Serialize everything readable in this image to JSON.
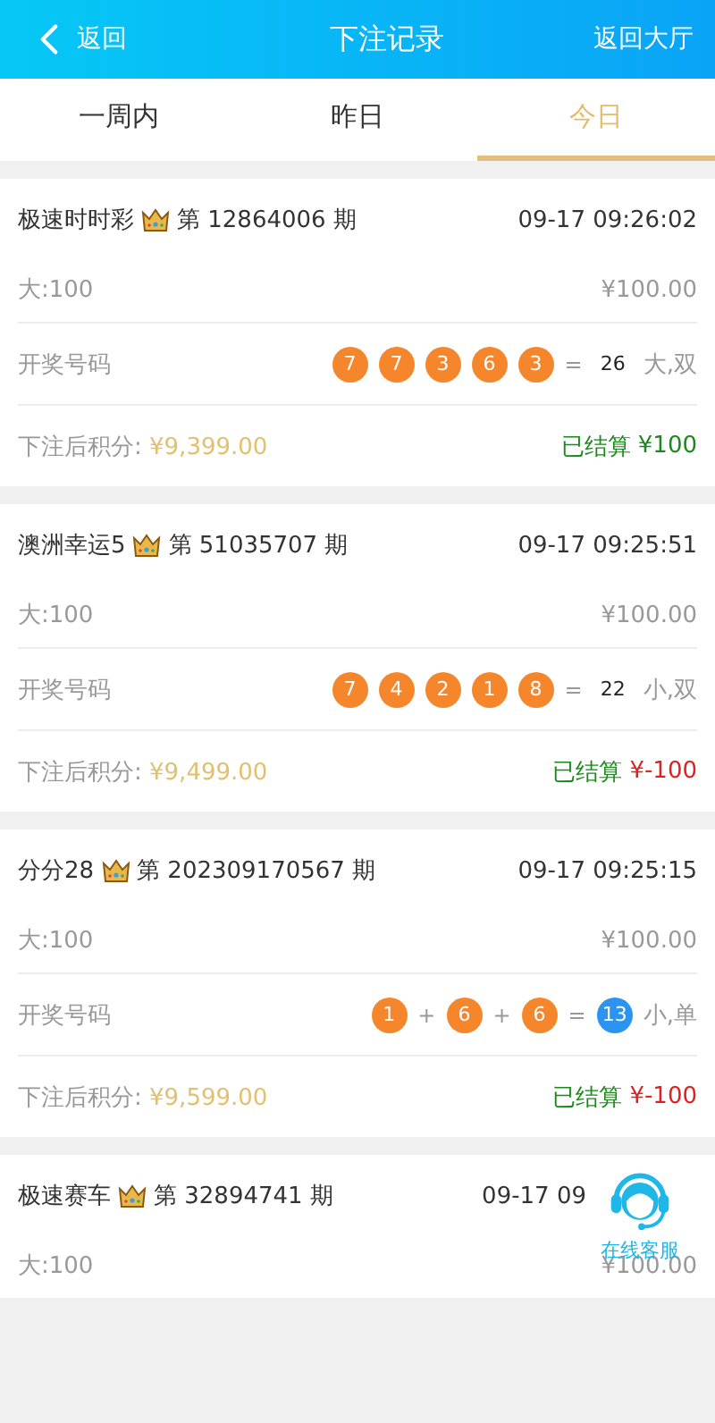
{
  "header": {
    "back": "返回",
    "title": "下注记录",
    "lobby": "返回大厅"
  },
  "tabs": [
    {
      "label": "一周内",
      "selected": false
    },
    {
      "label": "昨日",
      "selected": false
    },
    {
      "label": "今日",
      "selected": true
    }
  ],
  "records": [
    {
      "game": "极速时时彩",
      "issue": "第 12864006 期",
      "time": "09-17 09:26:02",
      "bet": "大:100",
      "amount": "¥100.00",
      "result_label": "开奖号码",
      "result": [
        {
          "kind": "ball",
          "text": "7",
          "color": "#f5862b"
        },
        {
          "kind": "ball",
          "text": "7",
          "color": "#f5862b"
        },
        {
          "kind": "ball",
          "text": "3",
          "color": "#f5862b"
        },
        {
          "kind": "ball",
          "text": "6",
          "color": "#f5862b"
        },
        {
          "kind": "ball",
          "text": "3",
          "color": "#f5862b"
        },
        {
          "kind": "op",
          "text": "="
        },
        {
          "kind": "sum",
          "text": "26"
        }
      ],
      "outcome": "大,双",
      "balance_label": "下注后积分:",
      "balance": "¥9,399.00",
      "status": "已结算",
      "payout": "¥100",
      "win": true
    },
    {
      "game": "澳洲幸运5",
      "issue": "第 51035707 期",
      "time": "09-17 09:25:51",
      "bet": "大:100",
      "amount": "¥100.00",
      "result_label": "开奖号码",
      "result": [
        {
          "kind": "ball",
          "text": "7",
          "color": "#f5862b"
        },
        {
          "kind": "ball",
          "text": "4",
          "color": "#f5862b"
        },
        {
          "kind": "ball",
          "text": "2",
          "color": "#f5862b"
        },
        {
          "kind": "ball",
          "text": "1",
          "color": "#f5862b"
        },
        {
          "kind": "ball",
          "text": "8",
          "color": "#f5862b"
        },
        {
          "kind": "op",
          "text": "="
        },
        {
          "kind": "sum",
          "text": "22"
        }
      ],
      "outcome": "小,双",
      "balance_label": "下注后积分:",
      "balance": "¥9,499.00",
      "status": "已结算",
      "payout": "¥-100",
      "win": false
    },
    {
      "game": "分分28",
      "issue": "第 202309170567 期",
      "time": "09-17 09:25:15",
      "bet": "大:100",
      "amount": "¥100.00",
      "result_label": "开奖号码",
      "result": [
        {
          "kind": "ball",
          "text": "1",
          "color": "#f5862b"
        },
        {
          "kind": "op",
          "text": "+"
        },
        {
          "kind": "ball",
          "text": "6",
          "color": "#f5862b"
        },
        {
          "kind": "op",
          "text": "+"
        },
        {
          "kind": "ball",
          "text": "6",
          "color": "#f5862b"
        },
        {
          "kind": "op",
          "text": "="
        },
        {
          "kind": "ball",
          "text": "13",
          "color": "#2b93f0"
        }
      ],
      "outcome": "小,单",
      "balance_label": "下注后积分:",
      "balance": "¥9,599.00",
      "status": "已结算",
      "payout": "¥-100",
      "win": false
    },
    {
      "game": "极速赛车",
      "issue": "第 32894741 期",
      "time": "09-17 09",
      "bet": "大:100",
      "amount": "¥100.00"
    }
  ],
  "support": {
    "label": "在线客服"
  }
}
